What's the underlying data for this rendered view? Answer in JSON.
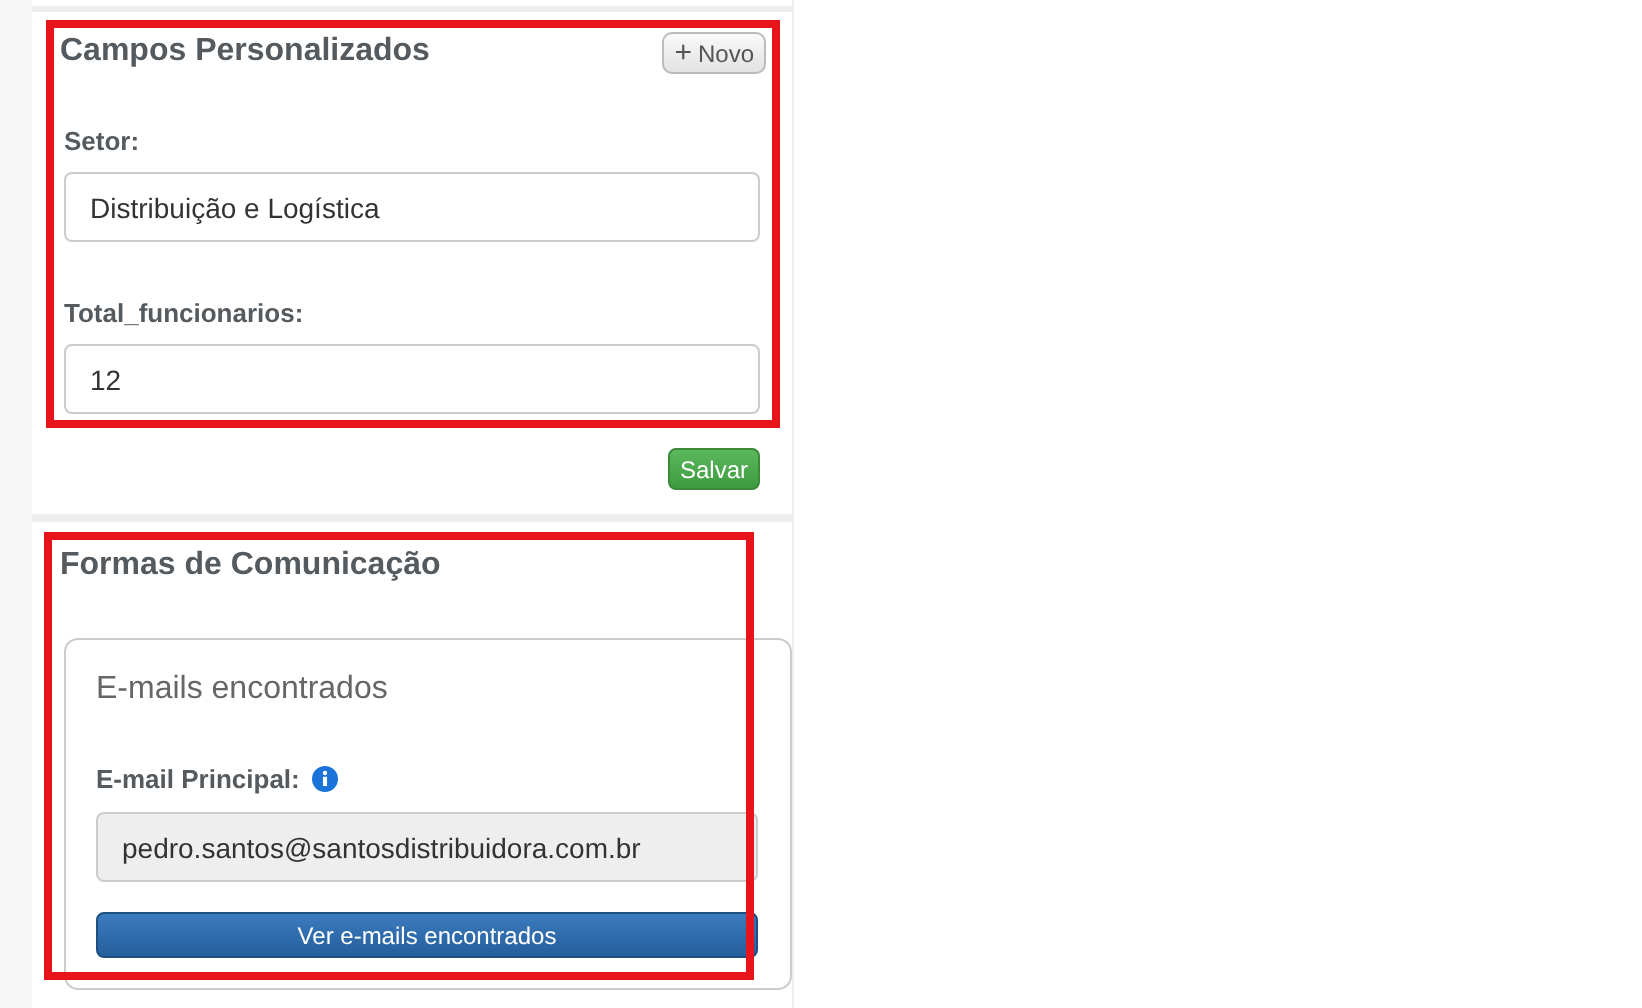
{
  "custom_fields": {
    "title": "Campos Personalizados",
    "new_button": {
      "icon": "+",
      "label": "Novo"
    },
    "fields": [
      {
        "label": "Setor:",
        "value": "Distribuição e Logística"
      },
      {
        "label": "Total_funcionarios:",
        "value": "12"
      }
    ],
    "save_button": "Salvar",
    "highlighted": true
  },
  "communication": {
    "title": "Formas de Comunicação",
    "highlighted": true,
    "card": {
      "title": "E-mails encontrados",
      "email_label": "E-mail Principal:",
      "email_value": "pedro.santos@santosdistribuidora.com.br",
      "button": "Ver e-mails encontrados"
    }
  }
}
